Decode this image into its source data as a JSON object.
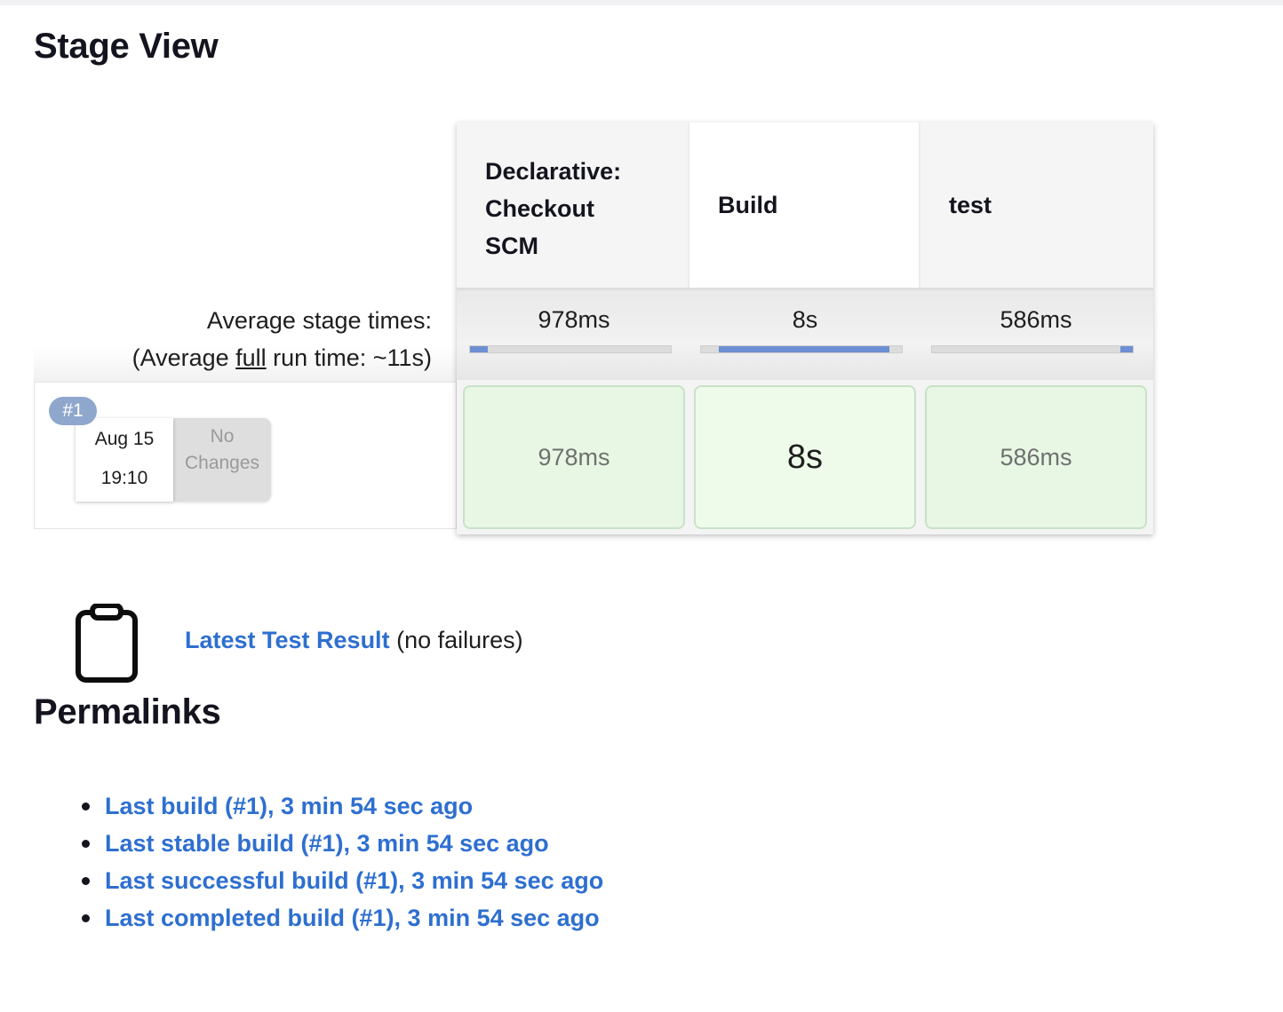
{
  "page": {
    "title": "Stage View"
  },
  "stage_view": {
    "stages": [
      {
        "name": "Declarative: Checkout SCM",
        "name_lines": [
          "Declarative:",
          "Checkout",
          "SCM"
        ],
        "avg_time": "978ms",
        "avg_fraction_start": 0.0,
        "avg_fraction": 0.09,
        "run_time": "978ms"
      },
      {
        "name": "Build",
        "avg_time": "8s",
        "avg_fraction_start": 0.09,
        "avg_fraction": 0.85,
        "run_time": "8s"
      },
      {
        "name": "test",
        "avg_time": "586ms",
        "avg_fraction_start": 0.94,
        "avg_fraction": 0.06,
        "run_time": "586ms"
      }
    ],
    "avg_label_line1": "Average stage times:",
    "avg_label_prefix": "(Average ",
    "avg_label_full": "full",
    "avg_label_suffix": " run time: ~11s)",
    "build": {
      "number": "#1",
      "date": "Aug 15",
      "time": "19:10",
      "changes": "No Changes",
      "changes_lines": [
        "No",
        "Changes"
      ]
    }
  },
  "test_result": {
    "link": "Latest Test Result",
    "note": "(no failures)"
  },
  "permalinks": {
    "title": "Permalinks",
    "items": [
      "Last build (#1), 3 min 54 sec ago",
      "Last stable build (#1), 3 min 54 sec ago",
      "Last successful build (#1), 3 min 54 sec ago",
      "Last completed build (#1), 3 min 54 sec ago"
    ]
  },
  "colors": {
    "link": "#2e6fd0",
    "success_bg": "#e7f7e3",
    "bar_fill": "#6d8fd3",
    "badge": "#8fa7cc"
  }
}
